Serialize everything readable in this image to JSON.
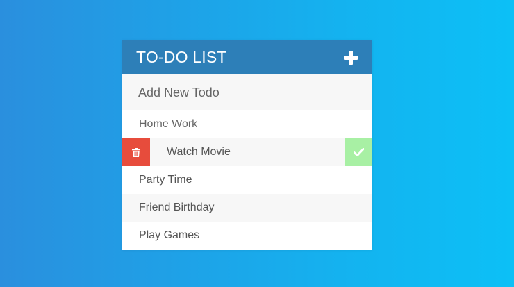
{
  "header": {
    "title": "TO-DO LIST",
    "add_icon": "plus-icon"
  },
  "new_todo": {
    "placeholder": "Add New Todo",
    "value": ""
  },
  "todos": [
    {
      "label": "Home Work",
      "completed": true
    },
    {
      "label": "Watch Movie",
      "completed": false,
      "hovered": true
    },
    {
      "label": "Party Time",
      "completed": false
    },
    {
      "label": "Friend Birthday",
      "completed": false
    },
    {
      "label": "Play Games",
      "completed": false
    }
  ],
  "icons": {
    "delete": "trash-icon",
    "complete": "check-icon"
  },
  "colors": {
    "header_bg": "#2d7fb8",
    "delete_bg": "#e74c3c",
    "complete_bg": "#a8f0a4",
    "background_start": "#2a8fde",
    "background_end": "#0cc0f6"
  }
}
